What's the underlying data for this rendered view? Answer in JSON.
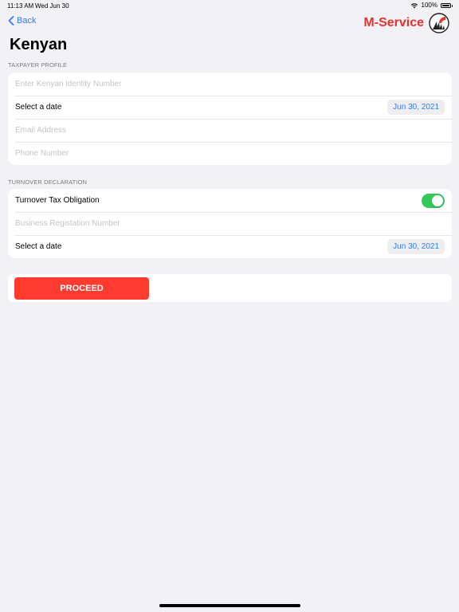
{
  "status": {
    "time": "11:13 AM",
    "date": "Wed Jun 30",
    "battery": "100%",
    "battery_level": 1.0
  },
  "nav": {
    "back_label": "Back",
    "brand_name": "M-Service"
  },
  "title": "Kenyan",
  "taxpayer_profile": {
    "header": "TAXPAYER PROFILE",
    "identity_placeholder": "Enter Kenyan identity Number",
    "date_label": "Select a date",
    "date_value": "Jun 30, 2021",
    "email_placeholder": "Email Address",
    "phone_placeholder": "Phone Number"
  },
  "turnover_declaration": {
    "header": "TURNOVER DECLARATION",
    "obligation_label": "Turnover Tax Obligation",
    "obligation_enabled": true,
    "registration_placeholder": "Business Registation Number",
    "date_label": "Select a date",
    "date_value": "Jun 30, 2021"
  },
  "proceed_label": "PROCEED",
  "colors": {
    "accent_blue": "#2f7cf6",
    "brand_red": "#e8322b",
    "button_red": "#ff3b30",
    "toggle_green": "#34c759",
    "background": "#f2f1f6"
  }
}
